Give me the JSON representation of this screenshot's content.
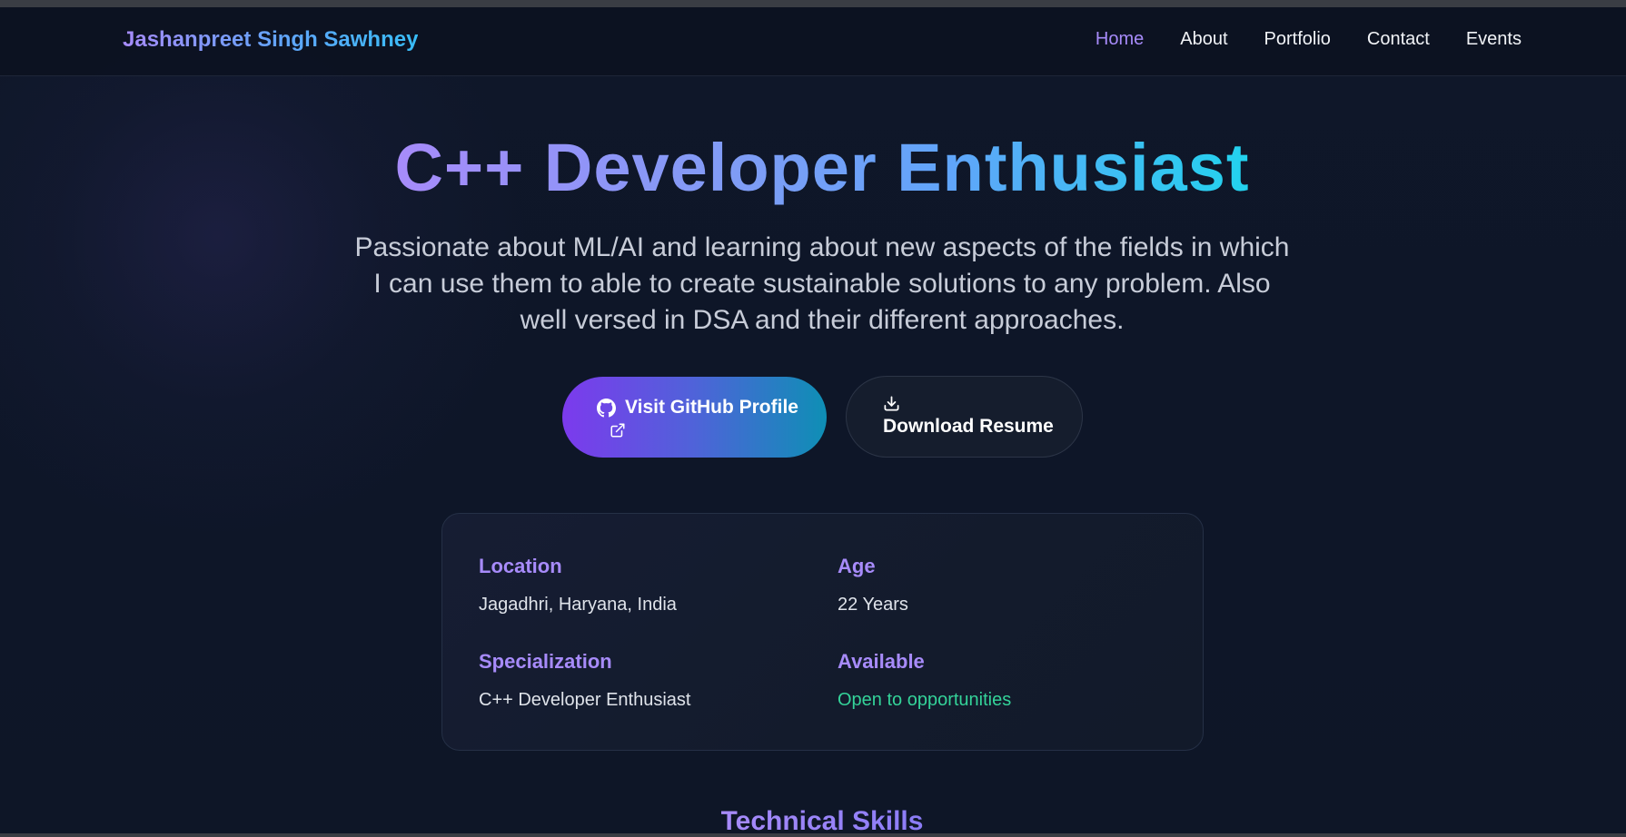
{
  "nav": {
    "brand": "Jashanpreet Singh Sawhney",
    "links": [
      {
        "label": "Home",
        "active": true
      },
      {
        "label": "About",
        "active": false
      },
      {
        "label": "Portfolio",
        "active": false
      },
      {
        "label": "Contact",
        "active": false
      },
      {
        "label": "Events",
        "active": false
      }
    ]
  },
  "hero": {
    "title": "C++ Developer Enthusiast",
    "subtitle": "Passionate about ML/AI and learning about new aspects of the fields in which I can use them to able to create sustainable solutions to any problem. Also well versed in DSA and their different approaches.",
    "primary_button": {
      "label": "Visit GitHub Profile",
      "icons": [
        "github-icon",
        "external-link-icon"
      ]
    },
    "secondary_button": {
      "label": "Download Resume",
      "icon": "download-icon"
    }
  },
  "info": {
    "location": {
      "label": "Location",
      "value": "Jagadhri, Haryana, India"
    },
    "age": {
      "label": "Age",
      "value": "22 Years"
    },
    "specialization": {
      "label": "Specialization",
      "value": "C++ Developer Enthusiast"
    },
    "available": {
      "label": "Available",
      "value": "Open to opportunities"
    }
  },
  "sections": {
    "skills_title": "Technical Skills"
  },
  "colors": {
    "accent_purple": "#a78bfa",
    "accent_cyan": "#22d3ee",
    "status_green": "#34d399",
    "background": "#0d1424"
  }
}
